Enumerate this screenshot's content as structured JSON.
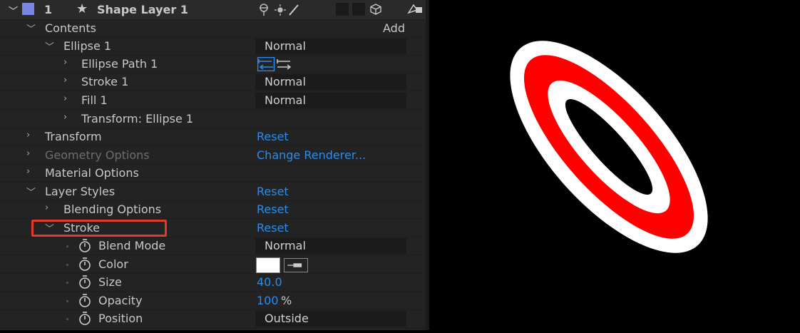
{
  "layer": {
    "number": "1",
    "name": "Shape Layer 1",
    "label_color": "#7b86e0"
  },
  "contents": {
    "label": "Contents",
    "add_label": "Add"
  },
  "ellipse": {
    "label": "Ellipse 1",
    "mode": "Normal"
  },
  "ellipse_path": {
    "label": "Ellipse Path 1"
  },
  "ellipse_stroke": {
    "label": "Stroke 1",
    "mode": "Normal"
  },
  "ellipse_fill": {
    "label": "Fill 1",
    "mode": "Normal"
  },
  "ellipse_transform": {
    "label": "Transform: Ellipse 1"
  },
  "transform": {
    "label": "Transform",
    "value": "Reset"
  },
  "geometry": {
    "label": "Geometry Options",
    "value": "Change Renderer..."
  },
  "material": {
    "label": "Material Options"
  },
  "layer_styles": {
    "label": "Layer Styles",
    "value": "Reset"
  },
  "blending": {
    "label": "Blending Options",
    "value": "Reset"
  },
  "stroke_style": {
    "label": "Stroke",
    "value": "Reset"
  },
  "blend_mode": {
    "label": "Blend Mode",
    "value": "Normal"
  },
  "color": {
    "label": "Color",
    "swatch": "#ffffff"
  },
  "size": {
    "label": "Size",
    "value": "40.0"
  },
  "opacity": {
    "label": "Opacity",
    "value": "100",
    "unit": "%"
  },
  "position": {
    "label": "Position",
    "value": "Outside"
  },
  "colors": {
    "accent": "#2d8ceb",
    "highlight": "#e23a2a",
    "ellipse_stroke": "#ffffff",
    "ellipse_fill": "#ff0000"
  }
}
